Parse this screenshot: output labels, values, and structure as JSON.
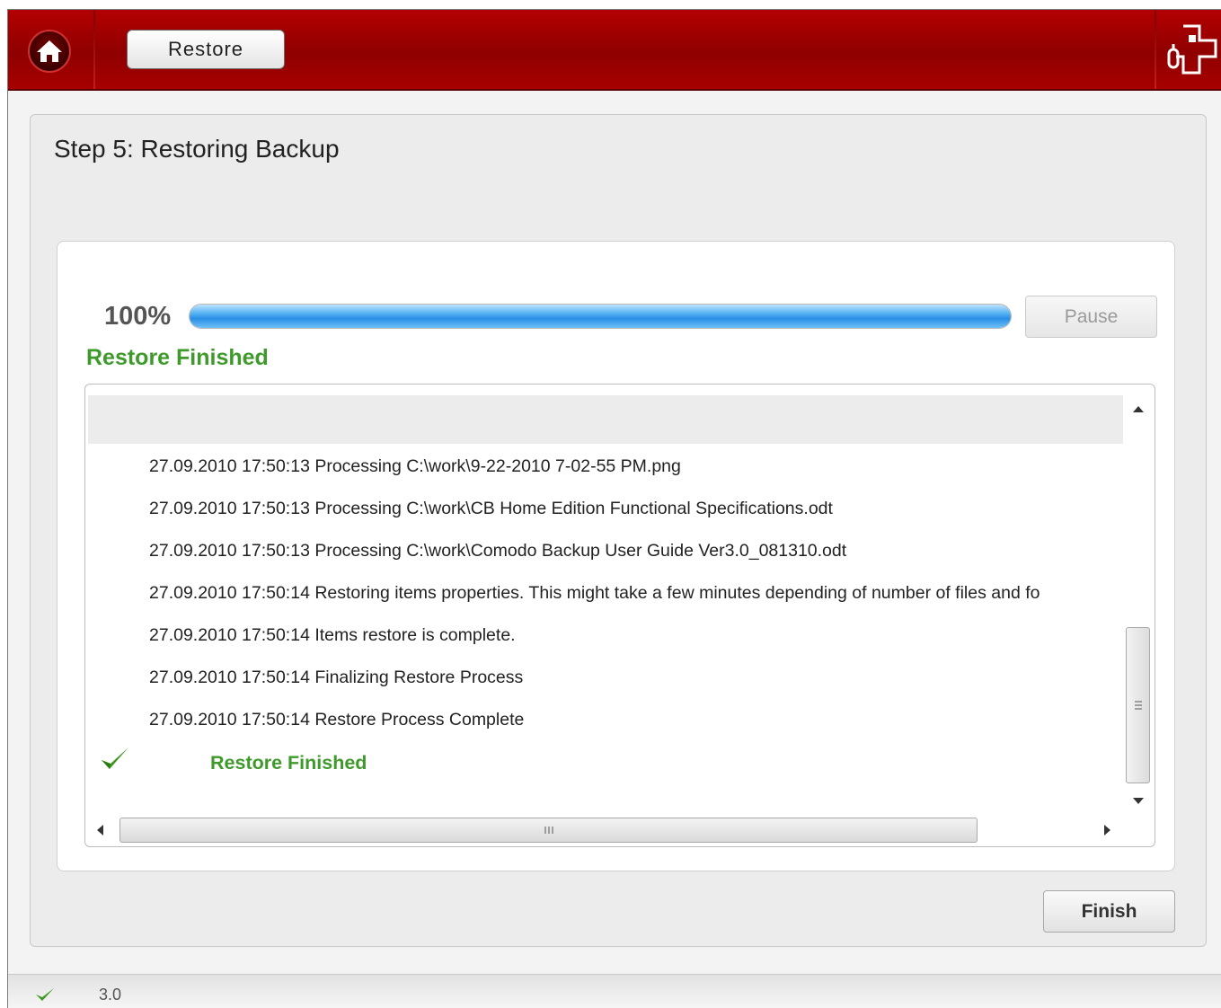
{
  "colors": {
    "header_red": "#9e0000",
    "success_green": "#3f9a2c",
    "progress_blue": "#2a8ee6"
  },
  "header": {
    "home_icon": "home-icon",
    "tab_label": "Restore",
    "logo_icon": "comodo-cross-icon"
  },
  "step": {
    "title": "Step 5: Restoring Backup"
  },
  "progress": {
    "percent_label": "100%",
    "value_fraction": 1.0,
    "pause_label": "Pause",
    "pause_enabled": false,
    "status": "Restore Finished"
  },
  "log": {
    "lines": [
      "27.09.2010 17:50:13 Processing C:\\work\\9-22-2010 7-02-55 PM.png",
      "27.09.2010 17:50:13 Processing C:\\work\\CB Home Edition Functional Specifications.odt",
      "27.09.2010 17:50:13 Processing C:\\work\\Comodo Backup User Guide Ver3.0_081310.odt",
      "27.09.2010 17:50:14 Restoring items properties. This might take a few minutes depending of number of files and fo",
      "27.09.2010 17:50:14 Items restore is complete.",
      "27.09.2010 17:50:14 Finalizing Restore Process",
      "27.09.2010 17:50:14 Restore Process Complete"
    ],
    "finished_icon": "check-icon",
    "finished_label": "Restore Finished"
  },
  "actions": {
    "finish_label": "Finish"
  },
  "footer": {
    "status_icon": "check-icon",
    "version": "3.0"
  }
}
